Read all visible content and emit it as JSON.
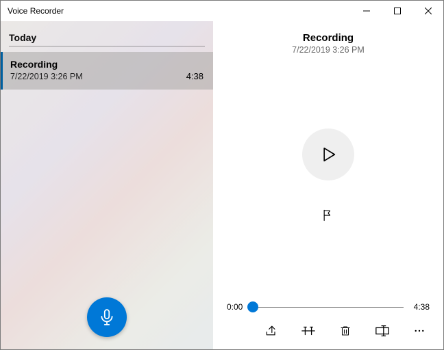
{
  "window": {
    "title": "Voice Recorder"
  },
  "colors": {
    "accent": "#0078d7"
  },
  "sidebar": {
    "group_header": "Today",
    "items": [
      {
        "title": "Recording",
        "subtitle": "7/22/2019 3:26 PM",
        "duration": "4:38",
        "selected": true
      }
    ]
  },
  "detail": {
    "title": "Recording",
    "subtitle": "7/22/2019 3:26 PM",
    "playback": {
      "current": "0:00",
      "total": "4:38",
      "position_fraction": 0
    }
  },
  "icons": {
    "record": "microphone-icon",
    "play": "play-icon",
    "flag": "flag-icon",
    "share": "share-icon",
    "trim": "trim-icon",
    "delete": "trash-icon",
    "rename": "rename-icon",
    "more": "more-icon"
  }
}
